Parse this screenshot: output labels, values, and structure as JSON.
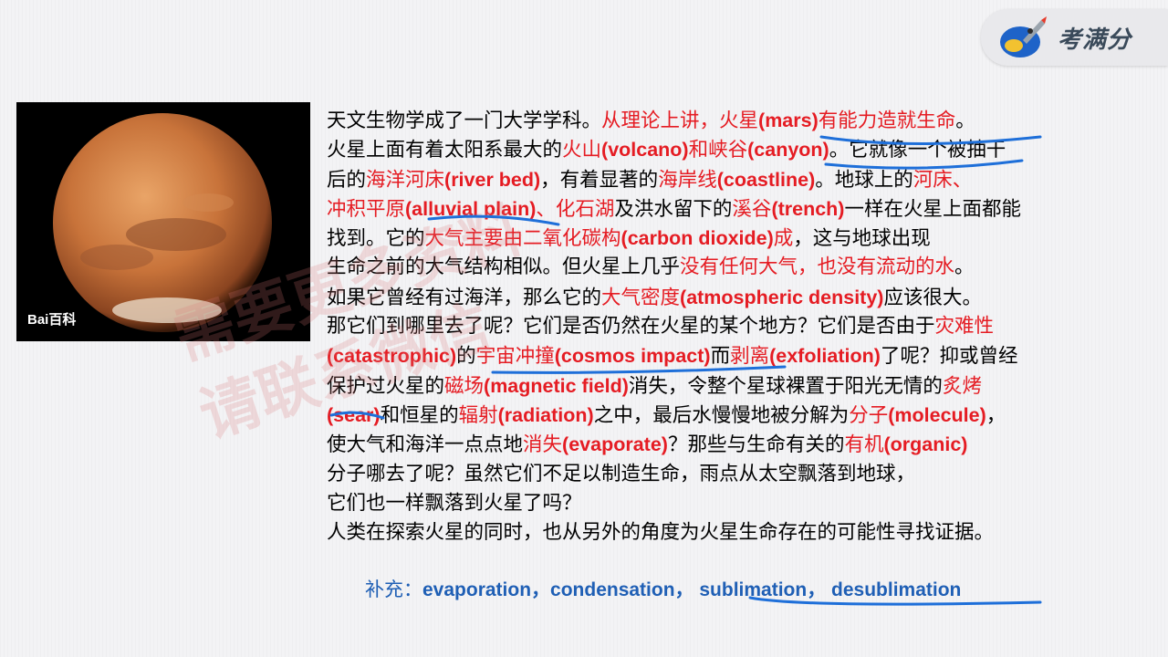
{
  "logo": {
    "name": "考满分"
  },
  "photo": {
    "watermark_text": "Bai百科"
  },
  "text_lines": [
    [
      {
        "t": "天文生物学成了一门大学学科。"
      },
      {
        "t": "从理论上讲，火星",
        "c": "red"
      },
      {
        "t": "(mars)",
        "c": "red",
        "en": true
      },
      {
        "t": "有能力造就生命",
        "c": "red"
      },
      {
        "t": "。"
      }
    ],
    [
      {
        "t": "火星上面有着太阳系最大的"
      },
      {
        "t": "火山",
        "c": "red"
      },
      {
        "t": "(volcano)",
        "c": "red",
        "en": true
      },
      {
        "t": "和峡谷",
        "c": "red"
      },
      {
        "t": "(canyon)",
        "c": "red",
        "en": true
      },
      {
        "t": "。它就像一个被抽干"
      }
    ],
    [
      {
        "t": "后的"
      },
      {
        "t": "海洋河床",
        "c": "red"
      },
      {
        "t": "(river bed)",
        "c": "red",
        "en": true
      },
      {
        "t": "，有着显著的"
      },
      {
        "t": "海岸线",
        "c": "red"
      },
      {
        "t": "(coastline)",
        "c": "red",
        "en": true
      },
      {
        "t": "。地球上的"
      },
      {
        "t": "河床、",
        "c": "red"
      }
    ],
    [
      {
        "t": "冲积平原",
        "c": "red"
      },
      {
        "t": "(alluvial plain)",
        "c": "red",
        "en": true
      },
      {
        "t": "、化石湖",
        "c": "red"
      },
      {
        "t": "及洪水留下的"
      },
      {
        "t": "溪谷",
        "c": "red"
      },
      {
        "t": "(trench)",
        "c": "red",
        "en": true
      },
      {
        "t": "一样在火星上面都能"
      }
    ],
    [
      {
        "t": "找到。它的"
      },
      {
        "t": "大气主要由二氧化碳构",
        "c": "red"
      },
      {
        "t": "(carbon dioxide)",
        "c": "red",
        "en": true
      },
      {
        "t": "成",
        "c": "red"
      },
      {
        "t": "，这与地球出现"
      }
    ],
    [
      {
        "t": "生命之前的大气结构相似。但火星上几乎"
      },
      {
        "t": "没有任何大气，也没有流动的水",
        "c": "red"
      },
      {
        "t": "。"
      }
    ],
    [
      {
        "t": "如果它曾经有过海洋，那么它的"
      },
      {
        "t": "大气密度",
        "c": "red"
      },
      {
        "t": "(atmospheric density)",
        "c": "red",
        "en": true
      },
      {
        "t": "应该很大。"
      }
    ],
    [
      {
        "t": "那它们到哪里去了呢？它们是否仍然在火星的某个地方？它们是否由于"
      },
      {
        "t": "灾难性",
        "c": "red"
      }
    ],
    [
      {
        "t": "(catastrophic)",
        "c": "red",
        "en": true
      },
      {
        "t": "的"
      },
      {
        "t": "宇宙冲撞",
        "c": "red"
      },
      {
        "t": "(cosmos impact)",
        "c": "red",
        "en": true
      },
      {
        "t": "而"
      },
      {
        "t": "剥离",
        "c": "red"
      },
      {
        "t": "(exfoliation)",
        "c": "red",
        "en": true
      },
      {
        "t": "了呢？抑或曾经"
      }
    ],
    [
      {
        "t": "保护过火星的"
      },
      {
        "t": "磁场",
        "c": "red"
      },
      {
        "t": "(magnetic field)",
        "c": "red",
        "en": true
      },
      {
        "t": "消失，令整个星球裸置于阳光无情的"
      },
      {
        "t": "炙烤",
        "c": "red"
      }
    ],
    [
      {
        "t": "(sear)",
        "c": "red",
        "en": true
      },
      {
        "t": "和恒星的"
      },
      {
        "t": "辐射",
        "c": "red"
      },
      {
        "t": "(radiation)",
        "c": "red",
        "en": true
      },
      {
        "t": "之中，最后水慢慢地被分解为"
      },
      {
        "t": "分子",
        "c": "red"
      },
      {
        "t": "(molecule)",
        "c": "red",
        "en": true
      },
      {
        "t": "，"
      }
    ],
    [
      {
        "t": "使大气和海洋一点点地"
      },
      {
        "t": "消失",
        "c": "red"
      },
      {
        "t": "(evaporate)",
        "c": "red",
        "en": true
      },
      {
        "t": "？那些与生命有关的"
      },
      {
        "t": "有机",
        "c": "red"
      },
      {
        "t": "(organic)",
        "c": "red",
        "en": true
      }
    ],
    [
      {
        "t": "分子哪去了呢？虽然它们不足以制造生命，雨点从太空飘落到地球，"
      }
    ],
    [
      {
        "t": "它们也一样飘落到火星了吗？"
      }
    ],
    [
      {
        "t": "人类在探索火星的同时，也从另外的角度为火星生命存在的可能性寻找证据。"
      }
    ]
  ],
  "supplement": {
    "label": "补充：",
    "terms": "evaporation，condensation， sublimation， desublimation"
  },
  "watermark": {
    "line1": "需要更多资料",
    "line2": "请联系微信"
  },
  "colors": {
    "red": "#e51c23",
    "blue": "#1f5fb5",
    "ink": "#1e6fd9"
  }
}
